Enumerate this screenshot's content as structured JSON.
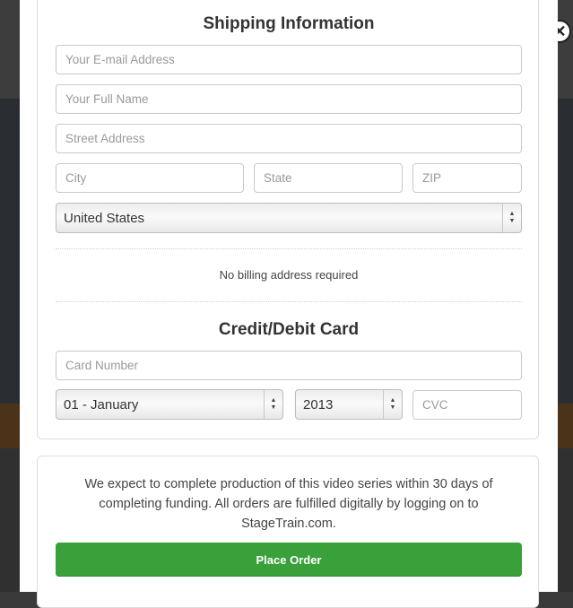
{
  "shipping": {
    "title": "Shipping Information",
    "email_placeholder": "Your E-mail Address",
    "name_placeholder": "Your Full Name",
    "street_placeholder": "Street Address",
    "city_placeholder": "City",
    "state_placeholder": "State",
    "zip_placeholder": "ZIP",
    "country_selected": "United States",
    "billing_note": "No billing address required"
  },
  "card": {
    "title": "Credit/Debit Card",
    "number_placeholder": "Card Number",
    "month_selected": "01 - January",
    "year_selected": "2013",
    "cvc_placeholder": "CVC"
  },
  "footer": {
    "info_lines": [
      "We expect to complete production of this video series within 30 days of",
      "completing funding. All orders are fulfilled digitally by logging on to",
      "StageTrain.com."
    ],
    "place_order_label": "Place Order"
  },
  "icons": {
    "close": "close-icon",
    "select_arrows": "updown-arrows-icon"
  },
  "colors": {
    "primary_button": "#3aa13a",
    "overlay": "#2c2c2c"
  }
}
